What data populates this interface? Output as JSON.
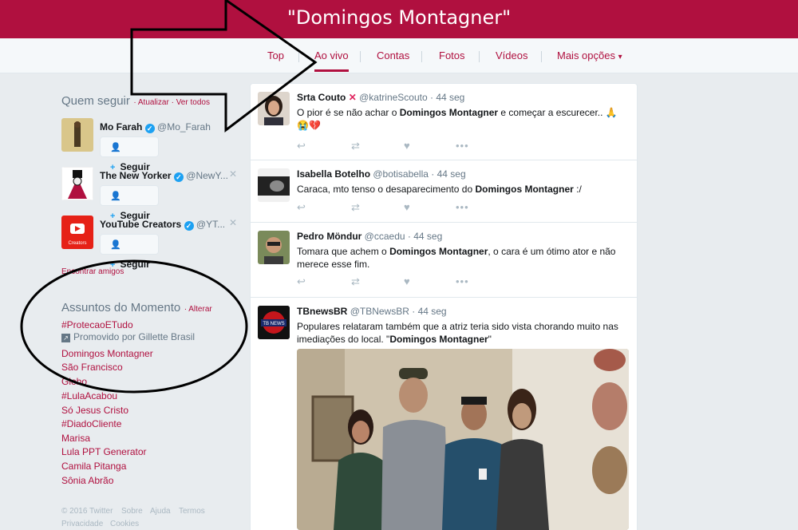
{
  "header": {
    "title": "\"Domingos Montagner\""
  },
  "nav": {
    "tabs": [
      "Top",
      "Ao vivo",
      "Contas",
      "Fotos",
      "Vídeos",
      "Mais opções"
    ],
    "active": "Ao vivo"
  },
  "who_to_follow": {
    "title": "Quem seguir",
    "refresh": "Atualizar",
    "view_all": "Ver todos",
    "follow_label": "Seguir",
    "items": [
      {
        "name": "Mo Farah",
        "handle": "@Mo_Farah"
      },
      {
        "name": "The New Yorker",
        "handle": "@NewY..."
      },
      {
        "name": "YouTube Creators",
        "handle": "@YT..."
      }
    ],
    "find_friends": "Encontrar amigos"
  },
  "trends": {
    "title": "Assuntos do Momento",
    "change": "Alterar",
    "promoted_tag": "#ProtecaoETudo",
    "promoted_by": "Promovido por Gillette Brasil",
    "items": [
      "Domingos Montagner",
      "São Francisco",
      "Globo",
      "#LulaAcabou",
      "Só Jesus Cristo",
      "#DiadoCliente",
      "Marisa",
      "Lula PPT Generator",
      "Camila Pitanga",
      "Sônia Abrão"
    ]
  },
  "footer": {
    "links": [
      "© 2016 Twitter",
      "Sobre",
      "Ajuda",
      "Termos",
      "Privacidade",
      "Cookies"
    ]
  },
  "tweets": [
    {
      "name": "Srta Couto",
      "handle": "@katrineScouto",
      "time": "44 seg",
      "text_before": "O pior é se não achar o ",
      "highlight": "Domingos Montagner",
      "text_after": " e começar a escurecer.. 🙏 😭💔"
    },
    {
      "name": "Isabella Botelho",
      "handle": "@botisabella",
      "time": "44 seg",
      "text_before": "Caraca, mto tenso o desaparecimento do ",
      "highlight": "Domingos Montagner",
      "text_after": " :/"
    },
    {
      "name": "Pedro Möndur",
      "handle": "@ccaedu",
      "time": "44 seg",
      "text_before": "Tomara que achem o ",
      "highlight": "Domingos Montagner",
      "text_after": ", o cara é um ótimo ator e não merece esse fim."
    },
    {
      "name": "TBnewsBR",
      "handle": "@TBNewsBR",
      "time": "44 seg",
      "text_before": "Populares relataram também que a atriz teria sido vista chorando muito nas imediações do local. \"",
      "highlight": "Domingos Montagner",
      "text_after": "\"",
      "avatar_label": "TB NEWS"
    }
  ],
  "icons": [
    "reply-icon",
    "retweet-icon",
    "like-icon",
    "more-icon",
    "verified-icon",
    "follow-person-icon",
    "dismiss-icon"
  ],
  "colors": {
    "brand": "#b0103f",
    "link_blue": "#1da1f2",
    "muted": "#657786"
  }
}
